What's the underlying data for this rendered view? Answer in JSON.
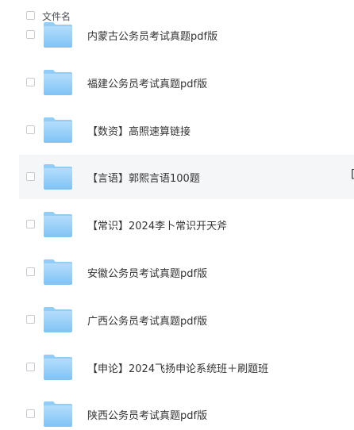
{
  "header": {
    "name_label": "文件名"
  },
  "rows": [
    {
      "name": "内蒙古公务员考试真题pdf版"
    },
    {
      "name": "福建公务员考试真题pdf版"
    },
    {
      "name": "【数资】高照速算链接"
    },
    {
      "name": "【言语】郭熙言语100题",
      "hovered": true,
      "edge_mark": "["
    },
    {
      "name": "【常识】2024李卜常识开天斧"
    },
    {
      "name": "安徽公务员考试真题pdf版"
    },
    {
      "name": "广西公务员考试真题pdf版"
    },
    {
      "name": "【申论】2024飞扬申论系统班＋刷题班"
    },
    {
      "name": "陕西公务员考试真题pdf版"
    }
  ],
  "colors": {
    "folder_top": "#a9d8fb",
    "folder_bottom": "#7fc3f5",
    "hover_bg": "#f5f6f8"
  },
  "icons": {
    "row_icon": "folder-icon",
    "select": "checkbox"
  }
}
